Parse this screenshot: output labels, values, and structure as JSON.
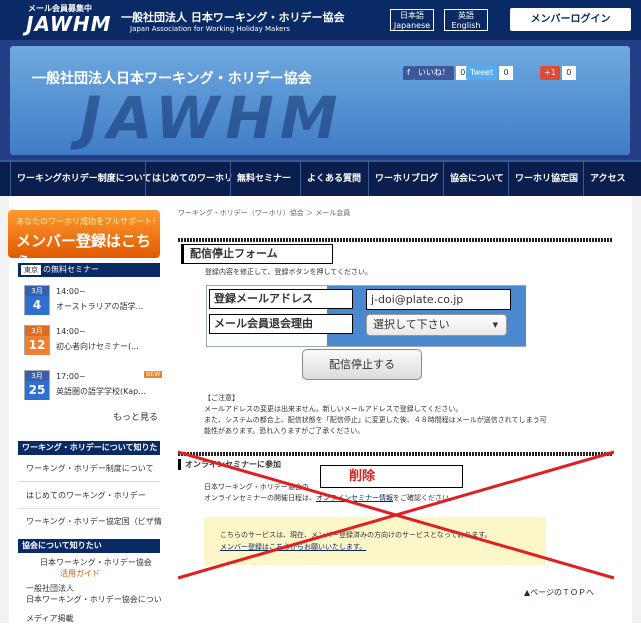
{
  "header": {
    "logo_small": "メール会員募集中",
    "logo_big": "JAWHM",
    "assoc_jp": "一般社団法人 日本ワーキング・ホリデー協会",
    "assoc_en": "Japan Association for Working Holiday Makers",
    "lang_ja_1": "日本語",
    "lang_ja_2": "Japanese",
    "lang_en_1": "英語",
    "lang_en_2": "English",
    "member_login": "メンバーログイン"
  },
  "banner": {
    "title": "一般社団法人日本ワーキング・ホリデー協会",
    "big": "JAWHM",
    "fb_label": "いいね！",
    "fb_count": "0",
    "tw_label": "Tweet",
    "tw_count": "0",
    "gp_label": "+1",
    "gp_count": "0"
  },
  "nav": [
    "ワーキングホリデー制度について",
    "はじめてのワーホリ",
    "無料セミナー",
    "よくある質問",
    "ワーホリブログ",
    "協会について",
    "ワーホリ協定国",
    "アクセス"
  ],
  "sidebar": {
    "join_small": "あなたのワーホリ成功をフルサポート！",
    "join_big": "メンバー登録はこちら",
    "seminar_city": "東京",
    "seminar_head": "の無料セミナー",
    "seminars": [
      {
        "month": "3月",
        "day": "4",
        "time": "14:00~",
        "title": "オーストラリアの語学..."
      },
      {
        "month": "3月",
        "day": "12",
        "time": "14:00~",
        "title": "初心者向けセミナー(..."
      },
      {
        "month": "3月",
        "day": "25",
        "time": "17:00~",
        "title": "英語圏の語学学校(Kap..."
      }
    ],
    "new_badge": "NEW",
    "more": "もっと見る",
    "sec_wh": "ワーキング・ホリデーについて知りた",
    "links_wh": [
      "ワーキング・ホリデー制度について",
      "はじめてのワーキング・ホリデー",
      "ワーキング・ホリデー協定国（ビザ情"
    ],
    "sec_assoc": "協会について知りたい",
    "assoc_link1a": "日本ワーキング・ホリデー協会",
    "assoc_link1b": "活用ガイド",
    "assoc_link2a": "一般社団法人",
    "assoc_link2b": "日本ワーキング・ホリデー協会につい",
    "assoc_link3": "メディア掲載"
  },
  "main": {
    "breadcrumb": "ワーキング・ホリデー（ワーホリ）協会 ＞ メール会員",
    "form_title": "配信停止フォーム",
    "form_sub": "登録内容を修正して、登録ボタンを押してください。",
    "label_email": "登録メールアドレス",
    "label_reason": "メール会員退会理由",
    "email_value": "j-doi@plate.co.jp",
    "reason_select": "選択して下さい",
    "submit": "配信停止する",
    "note_head": "【ご注意】",
    "note1": "メールアドレスの変更は出来ません。新しいメールアドレスで登録してください。",
    "note2": "また、システムの都合上、配信状態を「配信停止」に変更した後、４８時間程はメールが送信されてしまう可",
    "note3": "能性があります。恐れ入りますがご了承ください。",
    "online_title": "オンラインセミナーに参加",
    "delete_label": "削除",
    "online1": "日本ワーキング・ホリデー協会の",
    "online2": "オンラインセミナーの開催日程は、",
    "online2b": "オンラインセミナー情報",
    "online2c": "をご確認ください。",
    "yellow1": "こちらのサービスは、現在、メンバー登録済みの方向けのサービスとなっております。",
    "yellow2": "メンバー登録はこちらからお願いいたします。",
    "page_top": "▲ページのＴＯＰへ"
  },
  "colors": {
    "navy": "#0a2a66",
    "orange": "#e05a00",
    "strike": "#e02020"
  }
}
